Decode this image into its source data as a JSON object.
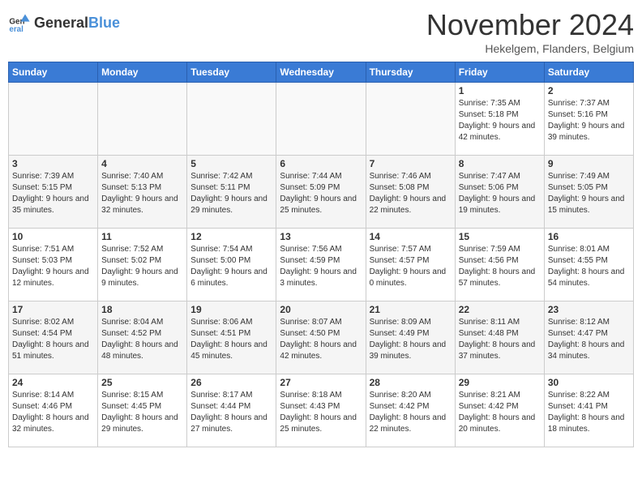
{
  "logo": {
    "text_general": "General",
    "text_blue": "Blue"
  },
  "title": "November 2024",
  "subtitle": "Hekelgem, Flanders, Belgium",
  "days_of_week": [
    "Sunday",
    "Monday",
    "Tuesday",
    "Wednesday",
    "Thursday",
    "Friday",
    "Saturday"
  ],
  "weeks": [
    [
      {
        "day": "",
        "info": ""
      },
      {
        "day": "",
        "info": ""
      },
      {
        "day": "",
        "info": ""
      },
      {
        "day": "",
        "info": ""
      },
      {
        "day": "",
        "info": ""
      },
      {
        "day": "1",
        "info": "Sunrise: 7:35 AM\nSunset: 5:18 PM\nDaylight: 9 hours and 42 minutes."
      },
      {
        "day": "2",
        "info": "Sunrise: 7:37 AM\nSunset: 5:16 PM\nDaylight: 9 hours and 39 minutes."
      }
    ],
    [
      {
        "day": "3",
        "info": "Sunrise: 7:39 AM\nSunset: 5:15 PM\nDaylight: 9 hours and 35 minutes."
      },
      {
        "day": "4",
        "info": "Sunrise: 7:40 AM\nSunset: 5:13 PM\nDaylight: 9 hours and 32 minutes."
      },
      {
        "day": "5",
        "info": "Sunrise: 7:42 AM\nSunset: 5:11 PM\nDaylight: 9 hours and 29 minutes."
      },
      {
        "day": "6",
        "info": "Sunrise: 7:44 AM\nSunset: 5:09 PM\nDaylight: 9 hours and 25 minutes."
      },
      {
        "day": "7",
        "info": "Sunrise: 7:46 AM\nSunset: 5:08 PM\nDaylight: 9 hours and 22 minutes."
      },
      {
        "day": "8",
        "info": "Sunrise: 7:47 AM\nSunset: 5:06 PM\nDaylight: 9 hours and 19 minutes."
      },
      {
        "day": "9",
        "info": "Sunrise: 7:49 AM\nSunset: 5:05 PM\nDaylight: 9 hours and 15 minutes."
      }
    ],
    [
      {
        "day": "10",
        "info": "Sunrise: 7:51 AM\nSunset: 5:03 PM\nDaylight: 9 hours and 12 minutes."
      },
      {
        "day": "11",
        "info": "Sunrise: 7:52 AM\nSunset: 5:02 PM\nDaylight: 9 hours and 9 minutes."
      },
      {
        "day": "12",
        "info": "Sunrise: 7:54 AM\nSunset: 5:00 PM\nDaylight: 9 hours and 6 minutes."
      },
      {
        "day": "13",
        "info": "Sunrise: 7:56 AM\nSunset: 4:59 PM\nDaylight: 9 hours and 3 minutes."
      },
      {
        "day": "14",
        "info": "Sunrise: 7:57 AM\nSunset: 4:57 PM\nDaylight: 9 hours and 0 minutes."
      },
      {
        "day": "15",
        "info": "Sunrise: 7:59 AM\nSunset: 4:56 PM\nDaylight: 8 hours and 57 minutes."
      },
      {
        "day": "16",
        "info": "Sunrise: 8:01 AM\nSunset: 4:55 PM\nDaylight: 8 hours and 54 minutes."
      }
    ],
    [
      {
        "day": "17",
        "info": "Sunrise: 8:02 AM\nSunset: 4:54 PM\nDaylight: 8 hours and 51 minutes."
      },
      {
        "day": "18",
        "info": "Sunrise: 8:04 AM\nSunset: 4:52 PM\nDaylight: 8 hours and 48 minutes."
      },
      {
        "day": "19",
        "info": "Sunrise: 8:06 AM\nSunset: 4:51 PM\nDaylight: 8 hours and 45 minutes."
      },
      {
        "day": "20",
        "info": "Sunrise: 8:07 AM\nSunset: 4:50 PM\nDaylight: 8 hours and 42 minutes."
      },
      {
        "day": "21",
        "info": "Sunrise: 8:09 AM\nSunset: 4:49 PM\nDaylight: 8 hours and 39 minutes."
      },
      {
        "day": "22",
        "info": "Sunrise: 8:11 AM\nSunset: 4:48 PM\nDaylight: 8 hours and 37 minutes."
      },
      {
        "day": "23",
        "info": "Sunrise: 8:12 AM\nSunset: 4:47 PM\nDaylight: 8 hours and 34 minutes."
      }
    ],
    [
      {
        "day": "24",
        "info": "Sunrise: 8:14 AM\nSunset: 4:46 PM\nDaylight: 8 hours and 32 minutes."
      },
      {
        "day": "25",
        "info": "Sunrise: 8:15 AM\nSunset: 4:45 PM\nDaylight: 8 hours and 29 minutes."
      },
      {
        "day": "26",
        "info": "Sunrise: 8:17 AM\nSunset: 4:44 PM\nDaylight: 8 hours and 27 minutes."
      },
      {
        "day": "27",
        "info": "Sunrise: 8:18 AM\nSunset: 4:43 PM\nDaylight: 8 hours and 25 minutes."
      },
      {
        "day": "28",
        "info": "Sunrise: 8:20 AM\nSunset: 4:42 PM\nDaylight: 8 hours and 22 minutes."
      },
      {
        "day": "29",
        "info": "Sunrise: 8:21 AM\nSunset: 4:42 PM\nDaylight: 8 hours and 20 minutes."
      },
      {
        "day": "30",
        "info": "Sunrise: 8:22 AM\nSunset: 4:41 PM\nDaylight: 8 hours and 18 minutes."
      }
    ]
  ]
}
